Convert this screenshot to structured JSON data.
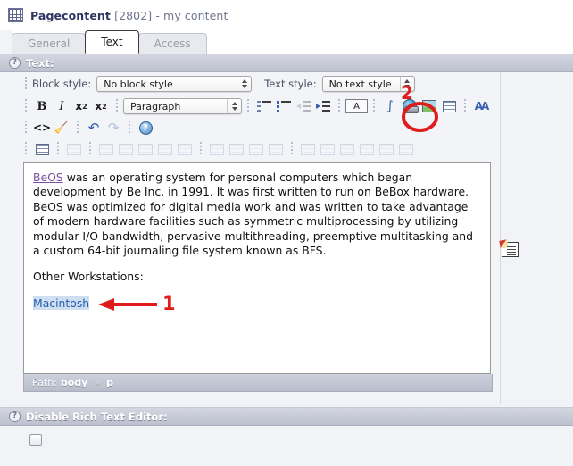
{
  "header": {
    "icon": "content-table-icon",
    "title_main": "Pagecontent",
    "title_id": "[2802]",
    "title_sep": "-",
    "title_sub": "my content"
  },
  "tabs": [
    {
      "label": "General",
      "active": false
    },
    {
      "label": "Text",
      "active": true
    },
    {
      "label": "Access",
      "active": false
    }
  ],
  "sections": {
    "text": {
      "help": "?",
      "label": "Text:"
    },
    "disable_rte": {
      "help": "?",
      "label": "Disable Rich Text Editor:",
      "checked": false
    }
  },
  "toolbar": {
    "block_style_label": "Block style:",
    "block_style_value": "No block style",
    "text_style_label": "Text style:",
    "text_style_value": "No text style",
    "format_value": "Paragraph",
    "bold": "B",
    "italic": "I",
    "subscript": "x",
    "subscript_idx": "2",
    "superscript": "x",
    "superscript_idx": "2",
    "anchor_letter": "A",
    "special_char": "∫",
    "find_replace": "AA",
    "code": "<>",
    "cleanup": "🧹",
    "undo": "↶",
    "redo": "↷",
    "help": "?",
    "buttons": [
      {
        "name": "bold-button",
        "enabled": true
      },
      {
        "name": "italic-button",
        "enabled": true
      },
      {
        "name": "subscript-button",
        "enabled": true
      },
      {
        "name": "superscript-button",
        "enabled": true
      },
      {
        "name": "numbered-list-button",
        "enabled": true
      },
      {
        "name": "bullet-list-button",
        "enabled": true
      },
      {
        "name": "outdent-button",
        "enabled": false
      },
      {
        "name": "indent-button",
        "enabled": true
      },
      {
        "name": "anchor-button",
        "enabled": true
      },
      {
        "name": "special-character-button",
        "enabled": true
      },
      {
        "name": "insert-link-button",
        "enabled": true
      },
      {
        "name": "insert-image-button",
        "enabled": true
      },
      {
        "name": "insert-table-button",
        "enabled": true
      },
      {
        "name": "find-replace-button",
        "enabled": true
      },
      {
        "name": "source-code-button",
        "enabled": true
      },
      {
        "name": "cleanup-button",
        "enabled": true
      },
      {
        "name": "undo-button",
        "enabled": true
      },
      {
        "name": "redo-button",
        "enabled": false
      },
      {
        "name": "help-button",
        "enabled": true
      }
    ],
    "table_row_disabled_count": 18
  },
  "content": {
    "paragraph1_link": "BeOS",
    "paragraph1_rest": " was an operating system for personal computers which began development by Be Inc. in 1991. It was first written to run on BeBox hardware. BeOS was optimized for digital media work and was written to take advantage of modern hardware facilities such as symmetric multiprocessing by utilizing modular I/O bandwidth, pervasive multithreading, preemptive multitasking and a custom 64-bit journaling file system known as BFS.",
    "paragraph2": "Other Workstations:",
    "paragraph3_selected": "Macintosh"
  },
  "pathbar": {
    "label": "Path:",
    "node1": "body",
    "chevron": "»",
    "node2": "p"
  },
  "annotations": {
    "marker_one": "1",
    "marker_two": "2",
    "color": "#e01b1b"
  },
  "side": {
    "icon": "edit-note-icon"
  }
}
